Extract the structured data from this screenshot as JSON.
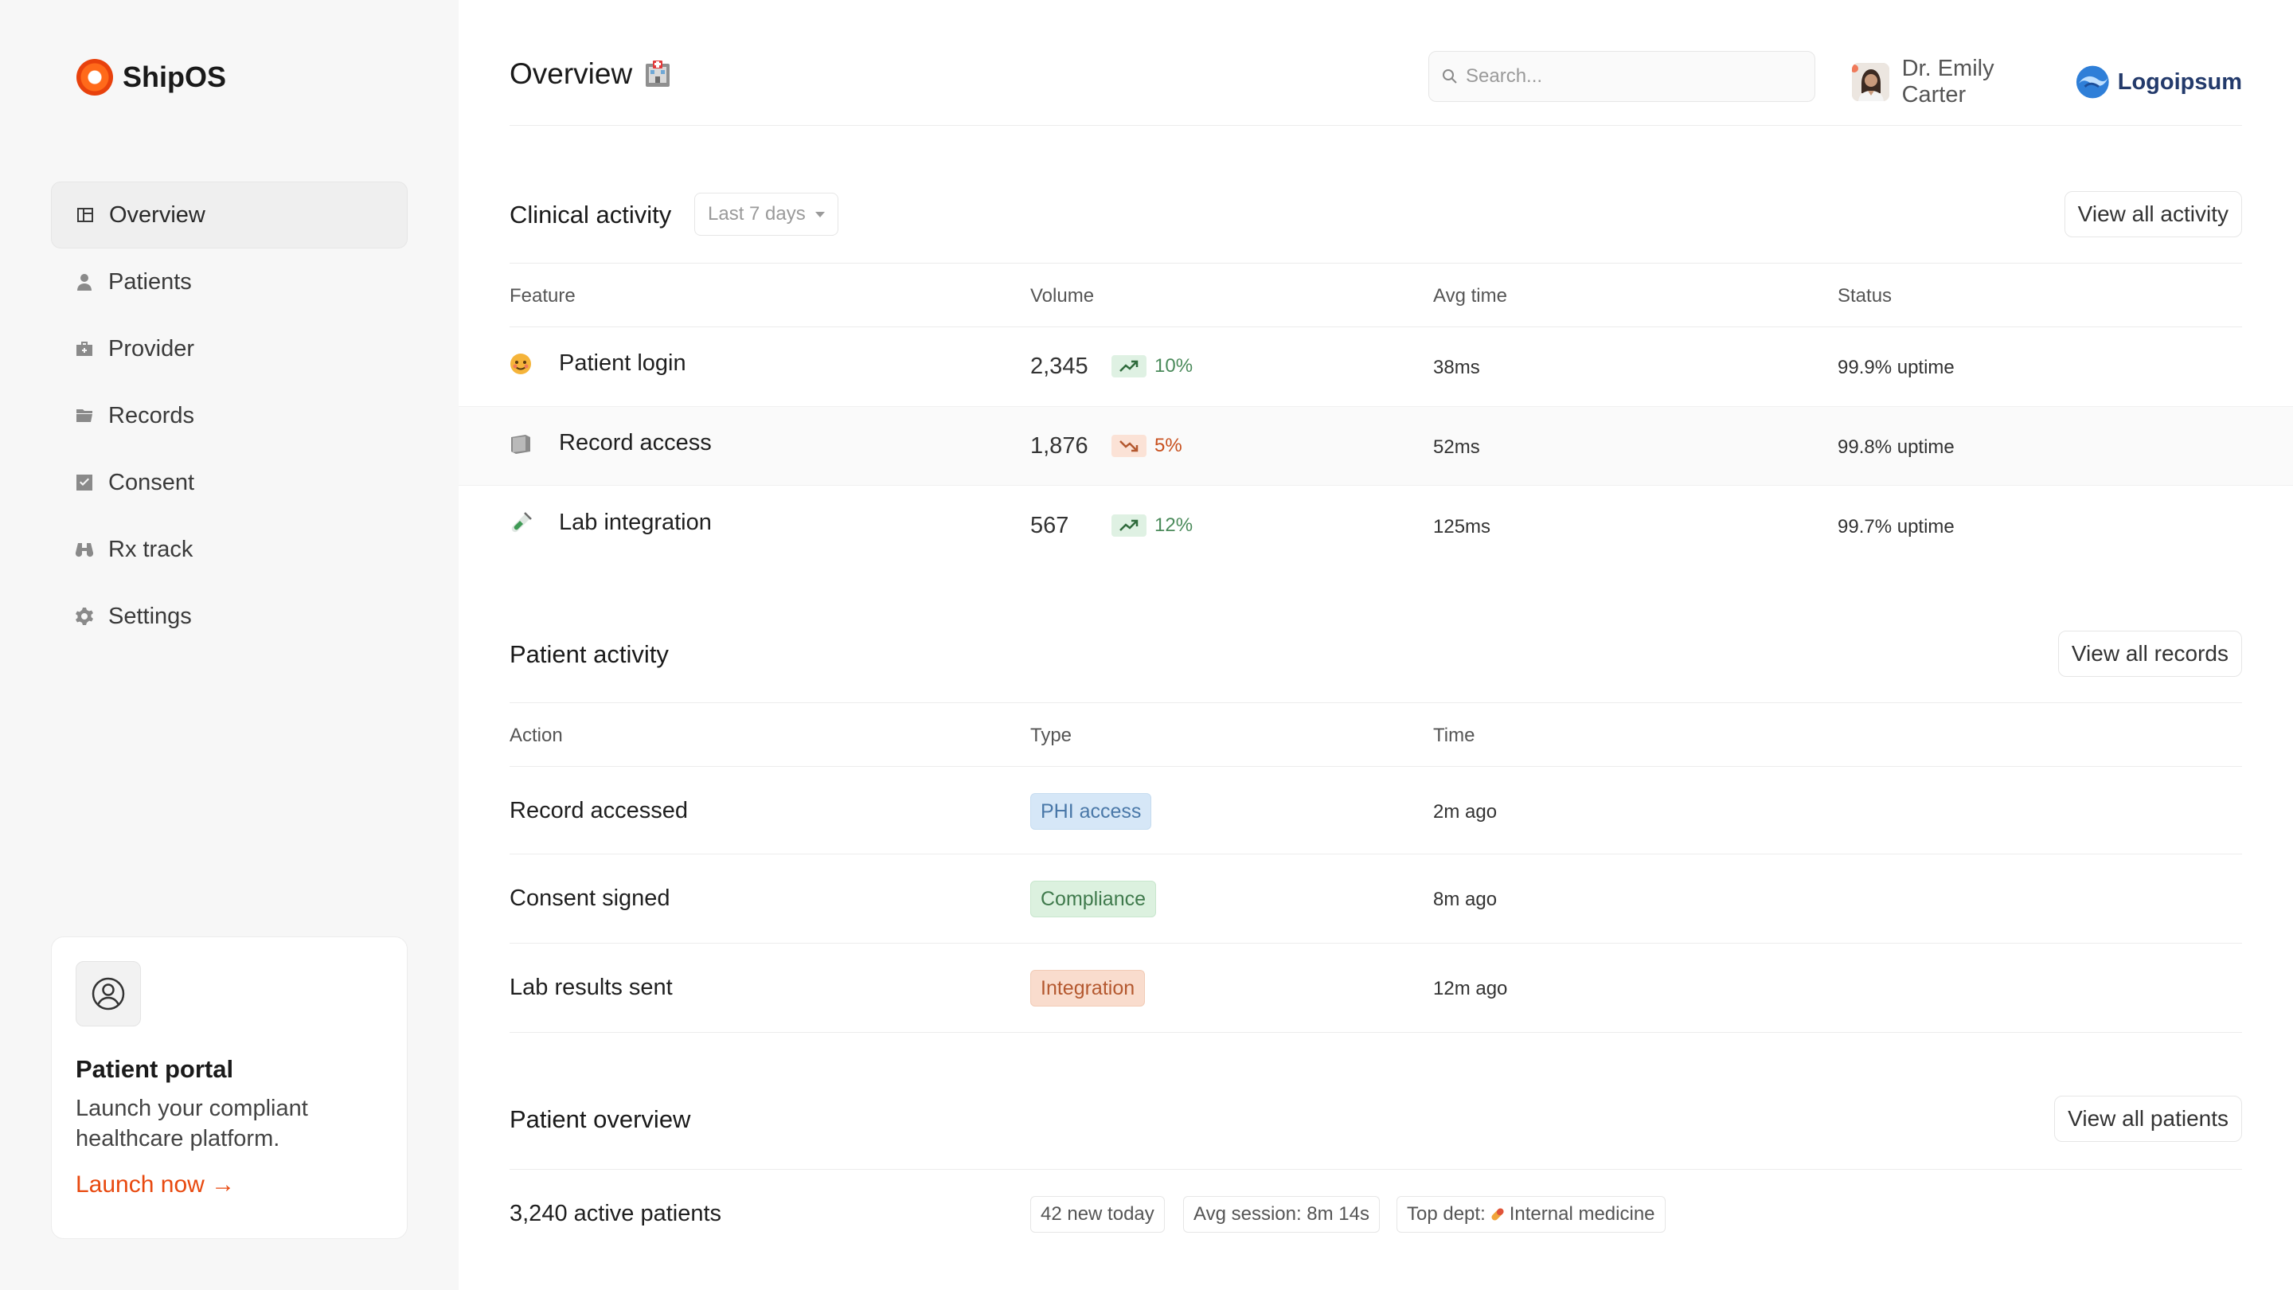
{
  "brand": {
    "name": "ShipOS"
  },
  "sidebar": {
    "items": [
      {
        "label": "Overview",
        "icon": "layout-icon",
        "active": true
      },
      {
        "label": "Patients",
        "icon": "person-icon"
      },
      {
        "label": "Provider",
        "icon": "briefcase-icon"
      },
      {
        "label": "Records",
        "icon": "folder-icon"
      },
      {
        "label": "Consent",
        "icon": "checkbox-icon"
      },
      {
        "label": "Rx track",
        "icon": "binoculars-icon"
      },
      {
        "label": "Settings",
        "icon": "gear-icon"
      }
    ]
  },
  "promo": {
    "title": "Patient portal",
    "text": "Launch your compliant healthcare platform.",
    "cta": "Launch now →"
  },
  "header": {
    "title": "Overview",
    "title_icon": "hospital-emoji-icon",
    "search_placeholder": "Search...",
    "user_name": "Dr. Emily Carter",
    "logo_text": "Logoipsum"
  },
  "clinical": {
    "title": "Clinical activity",
    "range": "Last 7 days",
    "view_all": "View all activity",
    "columns": [
      "Feature",
      "Volume",
      "Avg time",
      "Status"
    ],
    "rows": [
      {
        "feature": "Patient login",
        "icon": "face-emoji-icon",
        "volume": "2,345",
        "trend": "10%",
        "direction": "up",
        "avg_time": "38ms",
        "status": "99.9% uptime"
      },
      {
        "feature": "Record access",
        "icon": "notebook-emoji-icon",
        "volume": "1,876",
        "trend": "5%",
        "direction": "down",
        "avg_time": "52ms",
        "status": "99.8% uptime"
      },
      {
        "feature": "Lab integration",
        "icon": "test-tube-emoji-icon",
        "volume": "567",
        "trend": "12%",
        "direction": "up",
        "avg_time": "125ms",
        "status": "99.7% uptime"
      }
    ]
  },
  "patient_activity": {
    "title": "Patient activity",
    "view_all": "View all records",
    "columns": [
      "Action",
      "Type",
      "Time"
    ],
    "rows": [
      {
        "action": "Record accessed",
        "type": "PHI access",
        "time": "2m ago",
        "color": "#d6e7f7"
      },
      {
        "action": "Consent signed",
        "type": "Compliance",
        "time": "8m ago",
        "color": "#dcf1df"
      },
      {
        "action": "Lab results sent",
        "type": "Integration",
        "time": "12m ago",
        "color": "#f9dccd"
      }
    ]
  },
  "patient_overview": {
    "title": "Patient overview",
    "view_all": "View all patients",
    "active": "3,240 active patients",
    "chips": [
      "42 new today",
      "Avg session: 8m 14s"
    ],
    "top_dept_label": "Top dept:",
    "top_dept_value": "Internal medicine"
  },
  "colors": {
    "accent": "#e8490f",
    "brand_orange": "#ff6a1a"
  }
}
